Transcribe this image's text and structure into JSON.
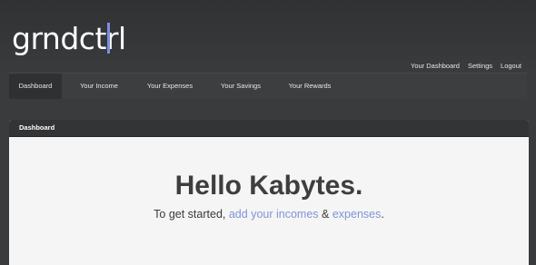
{
  "header": {
    "logo_text": "grndctrl",
    "top_links": [
      "Your Dashboard",
      "Settings",
      "Logout"
    ]
  },
  "nav": {
    "items": [
      {
        "label": "Dashboard",
        "active": true
      },
      {
        "label": "Your Income",
        "active": false
      },
      {
        "label": "Your Expenses",
        "active": false
      },
      {
        "label": "Your Savings",
        "active": false
      },
      {
        "label": "Your Rewards",
        "active": false
      }
    ]
  },
  "panel": {
    "title": "Dashboard",
    "greeting": "Hello Kabytes.",
    "intro_prefix": "To get started,",
    "link_incomes": "add your incomes",
    "ampersand": "&",
    "link_expenses": "expenses",
    "suffix": "."
  },
  "colors": {
    "background": "#3a3b3d",
    "accent": "#7b8fe0",
    "link": "#7f95d6",
    "panel": "#f5f5f5"
  }
}
